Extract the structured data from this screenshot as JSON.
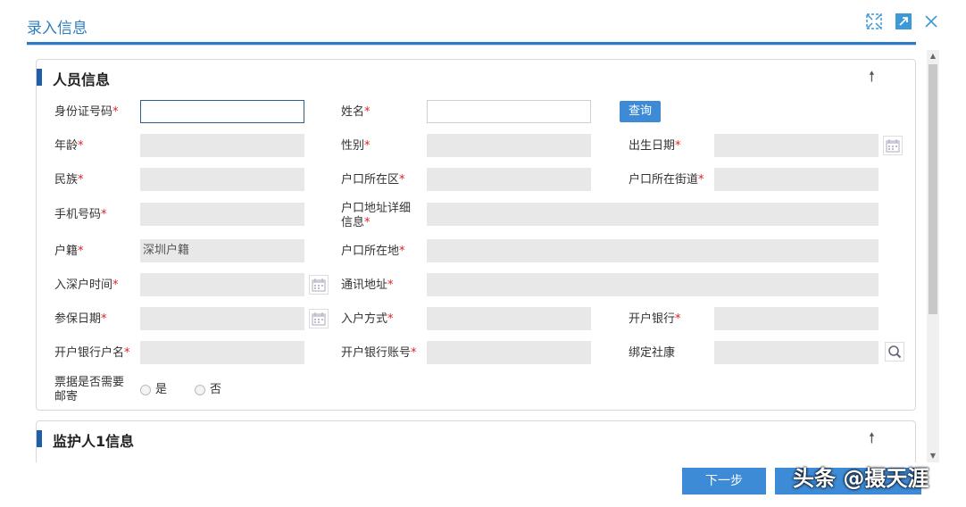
{
  "window": {
    "title": "录入信息"
  },
  "section1": {
    "title": "人员信息",
    "labels": {
      "id": "身份证号码",
      "name": "姓名",
      "query": "查询",
      "age": "年龄",
      "gender": "性别",
      "birth": "出生日期",
      "ethnic": "民族",
      "district": "户口所在区",
      "street": "户口所在街道",
      "phone": "手机号码",
      "addr_detail_1": "户口地址详细",
      "addr_detail_2": "信息",
      "huji": "户籍",
      "huji_value": "深圳户籍",
      "hukou_loc": "户口所在地",
      "entry_time": "入深户时间",
      "mail_addr": "通讯地址",
      "insure_date": "参保日期",
      "entry_way": "入户方式",
      "bank": "开户银行",
      "bank_name": "开户银行户名",
      "bank_acct": "开户银行账号",
      "bind_sk": "绑定社康",
      "mail_q1": "票据是否需要",
      "mail_q2": "邮寄",
      "yes": "是",
      "no": "否"
    }
  },
  "section2": {
    "title": "监护人1信息"
  },
  "footer": {
    "next": "下一步"
  },
  "watermark": "头条 @摄天涯",
  "required_mark": "*",
  "colors": {
    "accent": "#3d8ad6",
    "section_bar": "#1f5fa8",
    "required": "#e02020"
  }
}
